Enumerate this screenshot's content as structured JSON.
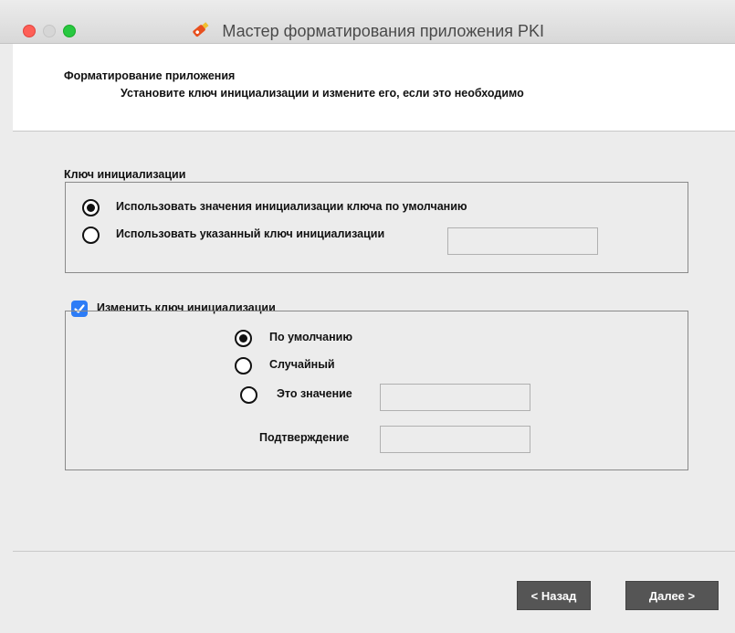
{
  "window": {
    "title": "Мастер форматирования приложения PKI"
  },
  "header": {
    "title": "Форматирование приложения",
    "subtitle": "Установите ключ инициализации и измените его, если это необходимо"
  },
  "init_key_group": {
    "label": "Ключ инициализации",
    "option_default": "Использовать значения инициализации ключа по умолчанию",
    "option_default_selected": true,
    "option_custom": "Использовать указанный ключ инициализации",
    "custom_value": ""
  },
  "change_key_group": {
    "label": "Изменить ключ инициализации",
    "checked": true,
    "option_default": "По умолчанию",
    "option_default_selected": true,
    "option_random": "Случайный",
    "option_value": "Это значение",
    "value_field": "",
    "confirm_label": "Подтверждение",
    "confirm_field": ""
  },
  "buttons": {
    "back": "< Назад",
    "next": "Далее >"
  },
  "colors": {
    "accent": "#2d7cf6",
    "button_bg": "#555555",
    "close": "#fe5f57",
    "maximize": "#28c840"
  },
  "icons": {
    "app": "usb-key-icon"
  }
}
